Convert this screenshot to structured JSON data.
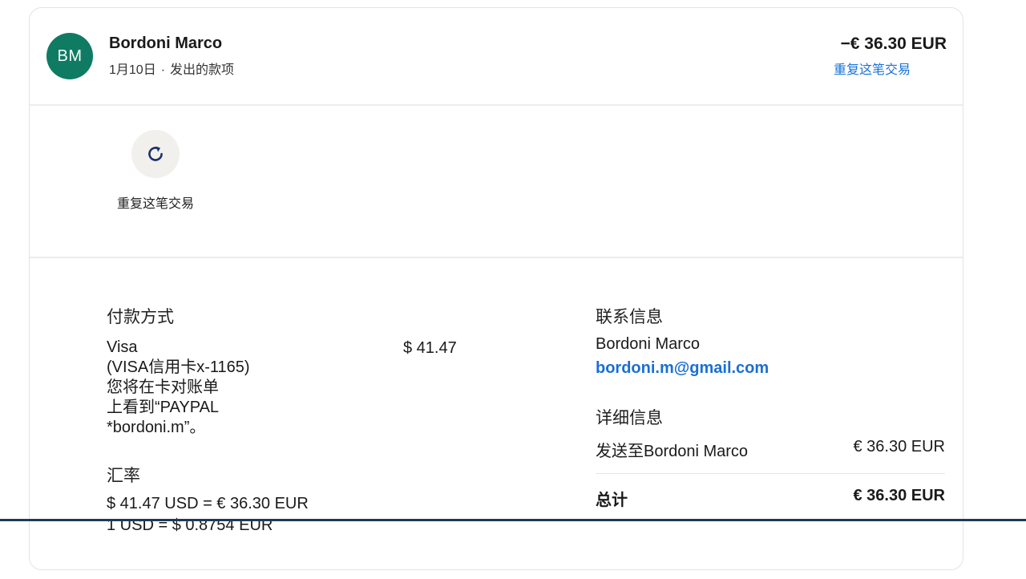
{
  "transaction": {
    "avatar_initials": "BM",
    "name": "Bordoni Marco",
    "date": "1月10日",
    "separator": "·",
    "type": "发出的款项",
    "amount": "−€ 36.30 EUR",
    "repeat_link": "重复这笔交易"
  },
  "actions": {
    "repeat_label": "重复这笔交易",
    "repeat_icon": "refresh-icon"
  },
  "payment": {
    "title": "付款方式",
    "method_lines": [
      "Visa",
      "(VISA信用卡x-1165)",
      "您将在卡对账单",
      "上看到“PAYPAL",
      "*bordoni.m”。"
    ],
    "amount": "$ 41.47"
  },
  "exchange": {
    "title": "汇率",
    "conversion": "$ 41.47 USD = € 36.30 EUR",
    "rate": "1 USD = $ 0.8754 EUR"
  },
  "contact": {
    "title": "联系信息",
    "name": "Bordoni Marco",
    "email": "bordoni.m@gmail.com"
  },
  "details": {
    "title": "详细信息",
    "sent_label": "发送至Bordoni Marco",
    "sent_amount": "€ 36.30 EUR",
    "total_label": "总计",
    "total_amount": "€ 36.30 EUR"
  },
  "colors": {
    "avatar": "#0f7b63",
    "link": "#1a73d6",
    "icon": "#1c2f6b"
  }
}
